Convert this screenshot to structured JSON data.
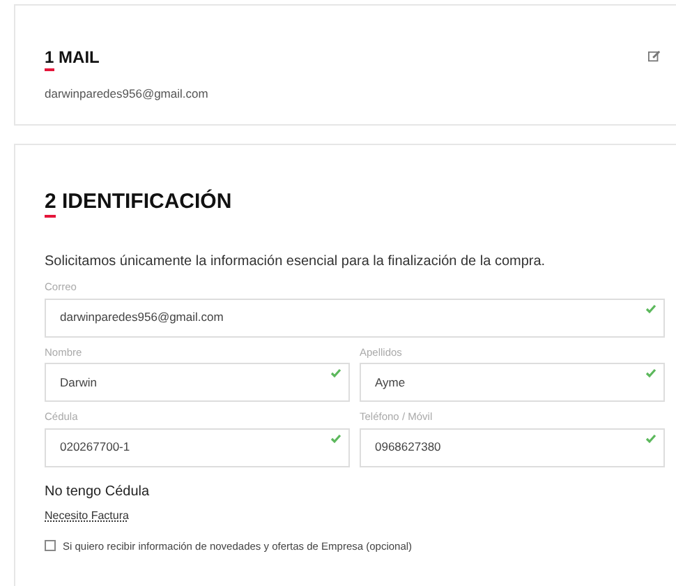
{
  "mail_section": {
    "number": "1",
    "title": "MAIL",
    "email": "darwinparedes956@gmail.com"
  },
  "identification_section": {
    "number": "2",
    "title": "IDENTIFICACIÓN",
    "intro": "Solicitamos únicamente la información esencial para la finalización de la compra.",
    "field_rows": [
      [
        {
          "label": "Correo",
          "value": "darwinparedes956@gmail.com",
          "valid": true
        }
      ],
      [
        {
          "label": "Nombre",
          "value": "Darwin",
          "valid": true
        },
        {
          "label": "Apellidos",
          "value": "Ayme",
          "valid": true
        }
      ],
      [
        {
          "label": "Cédula",
          "value": "020267700-1",
          "valid": true
        },
        {
          "label": "Teléfono / Móvil",
          "value": "0968627380",
          "valid": true
        }
      ]
    ],
    "no_id_link": "No tengo Cédula",
    "invoice_link": "Necesito Factura",
    "newsletter": {
      "label": "Si quiero recibir información de novedades y ofertas de Empresa (opcional)",
      "checked": false
    }
  }
}
